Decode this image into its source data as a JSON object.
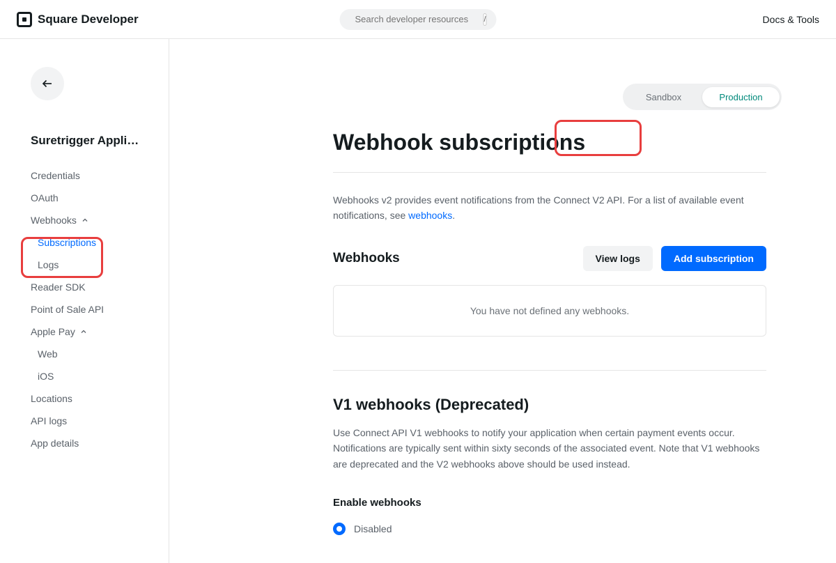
{
  "topbar": {
    "brand": "Square Developer",
    "search_placeholder": "Search developer resources",
    "slash_key": "/",
    "docs_tools": "Docs & Tools"
  },
  "sidebar": {
    "app_name": "Suretrigger Applica…",
    "items": {
      "credentials": "Credentials",
      "oauth": "OAuth",
      "webhooks": "Webhooks",
      "subscriptions": "Subscriptions",
      "logs": "Logs",
      "reader_sdk": "Reader SDK",
      "pos_api": "Point of Sale API",
      "apple_pay": "Apple Pay",
      "web": "Web",
      "ios": "iOS",
      "locations": "Locations",
      "api_logs": "API logs",
      "app_details": "App details"
    }
  },
  "env": {
    "sandbox": "Sandbox",
    "production": "Production"
  },
  "page": {
    "title": "Webhook subscriptions",
    "description_prefix": "Webhooks v2 provides event notifications from the Connect V2 API. For a list of available event notifications, see ",
    "description_link": "webhooks",
    "description_suffix": "."
  },
  "webhooks": {
    "section_title": "Webhooks",
    "view_logs": "View logs",
    "add_subscription": "Add subscription",
    "empty": "You have not defined any webhooks."
  },
  "v1": {
    "title": "V1 webhooks (Deprecated)",
    "description": "Use Connect API V1 webhooks to notify your application when certain payment events occur. Notifications are typically sent within sixty seconds of the associated event. Note that V1 webhooks are deprecated and the V2 webhooks above should be used instead.",
    "enable_title": "Enable webhooks",
    "disabled": "Disabled"
  }
}
